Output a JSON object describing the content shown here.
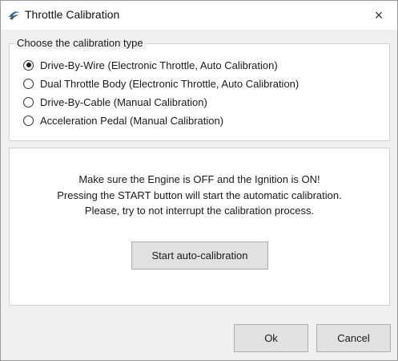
{
  "window": {
    "title": "Throttle Calibration",
    "close_glyph": "×",
    "app_icon": "throttle-app-icon"
  },
  "calibration_group": {
    "legend": "Choose the calibration type",
    "options": [
      {
        "label": "Drive-By-Wire (Electronic Throttle, Auto Calibration)",
        "checked": true
      },
      {
        "label": "Dual Throttle Body (Electronic Throttle, Auto Calibration)",
        "checked": false
      },
      {
        "label": "Drive-By-Cable (Manual Calibration)",
        "checked": false
      },
      {
        "label": "Acceleration Pedal (Manual Calibration)",
        "checked": false
      }
    ]
  },
  "instructions": {
    "lines": [
      "Make sure the Engine is OFF and the Ignition is ON!",
      "Pressing the START button will start the automatic calibration.",
      "Please, try to not interrupt the calibration process."
    ],
    "start_label": "Start auto-calibration"
  },
  "footer": {
    "ok_label": "Ok",
    "cancel_label": "Cancel"
  },
  "colors": {
    "window_bg": "#f0f0f0",
    "panel_bg": "#ffffff",
    "button_bg": "#e1e1e1",
    "border": "#adadad",
    "icon_blue": "#1e6ab0"
  }
}
